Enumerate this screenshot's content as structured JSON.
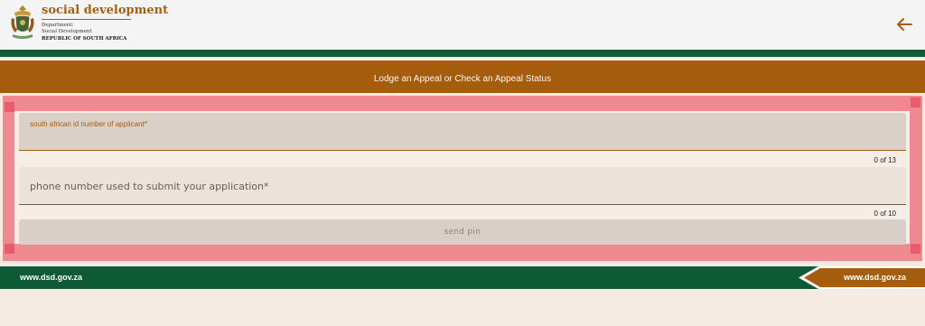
{
  "header": {
    "brand_title": "social development",
    "brand_line1": "Department:",
    "brand_line2": "Social Development",
    "brand_country": "REPUBLIC OF SOUTH AFRICA",
    "back_icon": "arrow-left-icon"
  },
  "banner": {
    "title": "Lodge an Appeal or Check an Appeal Status"
  },
  "form": {
    "id_field": {
      "label": "south african id number of applicant*",
      "value": "",
      "counter": "0 of 13"
    },
    "phone_field": {
      "placeholder": "phone number used to submit your application*",
      "value": "",
      "counter": "0 of 10"
    },
    "send_button": "send pin"
  },
  "footer": {
    "url_left": "www.dsd.gov.za",
    "url_right": "www.dsd.gov.za"
  },
  "colors": {
    "brand_brown": "#a65c0d",
    "brand_green": "#0f5a36",
    "highlight": "#ee8a90"
  }
}
